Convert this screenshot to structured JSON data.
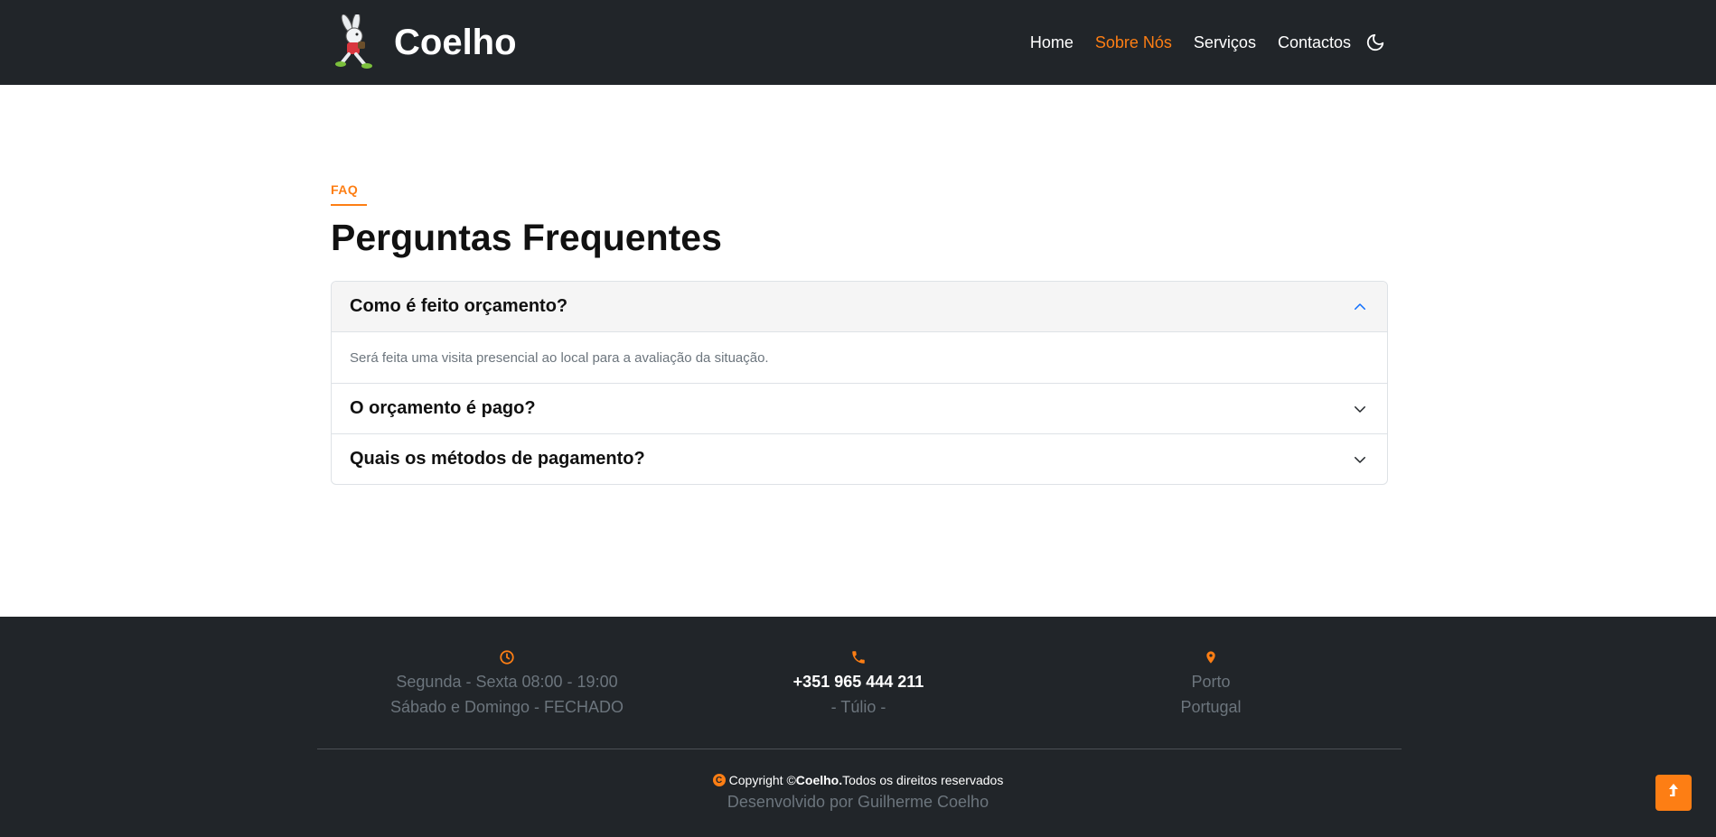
{
  "brand": {
    "name": "Coelho",
    "logo_icon": "rabbit-mascot-icon"
  },
  "nav": {
    "items": [
      {
        "label": "Home",
        "active": false
      },
      {
        "label": "Sobre Nós",
        "active": true
      },
      {
        "label": "Serviços",
        "active": false
      },
      {
        "label": "Contactos",
        "active": false
      }
    ],
    "theme_toggle_icon": "moon-icon"
  },
  "faq": {
    "eyebrow": "FAQ",
    "title": "Perguntas Frequentes",
    "items": [
      {
        "question": "Como é feito orçamento?",
        "answer": "Será feita uma visita presencial ao local para a avaliação da situação.",
        "open": true
      },
      {
        "question": "O orçamento é pago?",
        "open": false
      },
      {
        "question": "Quais os métodos de pagamento?",
        "open": false
      }
    ]
  },
  "footer": {
    "hours": {
      "icon": "clock-icon",
      "line1": "Segunda - Sexta 08:00 - 19:00",
      "line2": "Sábado e Domingo - FECHADO"
    },
    "phone": {
      "icon": "phone-icon",
      "number": "+351 965 444 211",
      "name": "- Túlio -"
    },
    "location": {
      "icon": "map-pin-icon",
      "city": "Porto",
      "country": "Portugal"
    },
    "copyright_prefix": "Copyright ©",
    "copyright_brand": "Coelho.",
    "copyright_suffix": "Todos os direitos reservados",
    "developer": "Desenvolvido por Guilherme Coelho"
  },
  "colors": {
    "accent": "#fd7e14",
    "dark": "#212529",
    "open_chevron": "#0d6efd"
  },
  "back_to_top_icon": "arrow-up-icon"
}
